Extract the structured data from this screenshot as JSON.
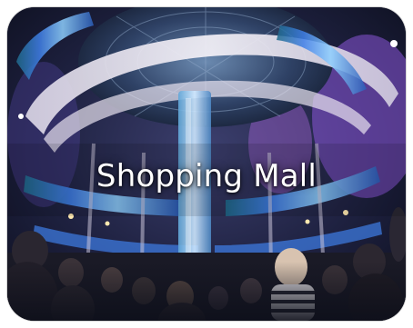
{
  "tile": {
    "label": "Shopping Mall",
    "image_icon": "shopping-mall-atrium-photo"
  },
  "colors": {
    "label_text": "#ffffff",
    "dome_accent": "#8a55d8",
    "led_banner": "#3f7fe8",
    "ceiling_glow": "#e8e2ef",
    "background": "#161a2e"
  }
}
